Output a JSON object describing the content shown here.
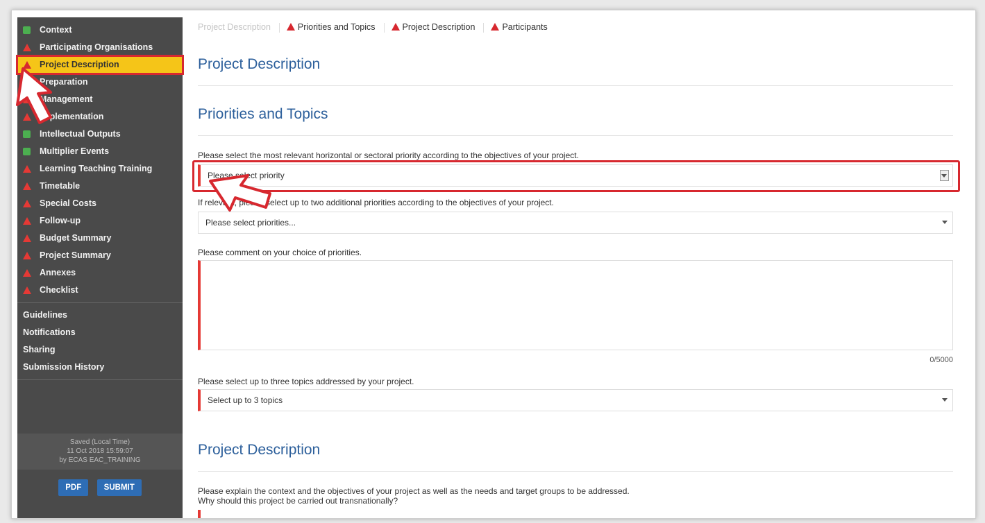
{
  "sidebar": {
    "items": [
      {
        "label": "Context",
        "status": "ok"
      },
      {
        "label": "Participating Organisations",
        "status": "warning"
      },
      {
        "label": "Project Description",
        "status": "warning",
        "active": true
      },
      {
        "label": "Preparation",
        "status": "warning"
      },
      {
        "label": "Management",
        "status": "warning"
      },
      {
        "label": "Implementation",
        "status": "warning"
      },
      {
        "label": "Intellectual Outputs",
        "status": "ok"
      },
      {
        "label": "Multiplier Events",
        "status": "ok"
      },
      {
        "label": "Learning Teaching Training",
        "status": "warning"
      },
      {
        "label": "Timetable",
        "status": "warning"
      },
      {
        "label": "Special Costs",
        "status": "warning"
      },
      {
        "label": "Follow-up",
        "status": "warning"
      },
      {
        "label": "Budget Summary",
        "status": "warning"
      },
      {
        "label": "Project Summary",
        "status": "warning"
      },
      {
        "label": "Annexes",
        "status": "warning"
      },
      {
        "label": "Checklist",
        "status": "warning"
      }
    ],
    "links": [
      "Guidelines",
      "Notifications",
      "Sharing",
      "Submission History"
    ],
    "saved": {
      "line1": "Saved (Local Time)",
      "line2": "11 Oct 2018 15:59:07",
      "line3": "by ECAS EAC_TRAINING"
    },
    "buttons": {
      "pdf": "PDF",
      "submit": "SUBMIT"
    }
  },
  "breadcrumb": {
    "items": [
      {
        "label": "Project Description",
        "faded": true,
        "warning": false
      },
      {
        "label": "Priorities and Topics",
        "faded": false,
        "warning": true
      },
      {
        "label": "Project Description",
        "faded": false,
        "warning": true
      },
      {
        "label": "Participants",
        "faded": false,
        "warning": true
      }
    ]
  },
  "main": {
    "title": "Project Description",
    "priorities_heading": "Priorities and Topics",
    "priority_label": "Please select the most relevant horizontal or sectoral priority according to the objectives of your project.",
    "priority_placeholder": "Please select priority",
    "additional_label": "If relevant, please select up to two additional priorities according to the objectives of your project.",
    "additional_placeholder": "Please select priorities...",
    "comment_label": "Please comment on your choice of priorities.",
    "comment_counter": "0/5000",
    "topics_label": "Please select up to three topics addressed by your project.",
    "topics_placeholder": "Select up to 3 topics",
    "desc_heading": "Project Description",
    "desc_label_1": "Please explain the context and the objectives of your project as well as the needs and target groups to be addressed.",
    "desc_label_2": "Why should this project be carried out transnationally?"
  },
  "colors": {
    "sidebar_bg": "#4a4a4a",
    "active_bg": "#f5c518",
    "highlight": "#d7282f",
    "heading": "#2c5f9b",
    "button": "#2e6db5"
  }
}
